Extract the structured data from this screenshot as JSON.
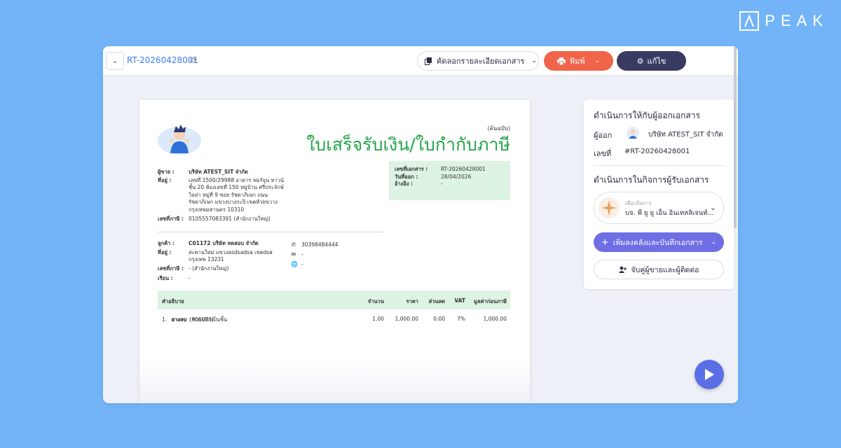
{
  "brand": {
    "name": "PEAK"
  },
  "toolbar": {
    "doc_id": "RT-20260428001",
    "copy_label": "คัดลอกรายละเอียดเอกสาร",
    "print_label": "พิมพ์",
    "edit_label": "แก้ไข"
  },
  "document": {
    "original_label": "(ต้นฉบับ)",
    "title": "ใบเสร็จรับเงิน/ใบกำกับภาษี",
    "seller": {
      "seller_label": "ผู้ขาย :",
      "seller_value": "บริษัท ATEST_SIT จำกัด",
      "address_label": "ที่อยู่ :",
      "address_lines": [
        "เลขที่ 1500/29988 อาคาร ฟอร์จูน ทาวน์",
        "ชั้น 20 ห้องเลขที่ 150 หมู่บ้าน ศรีประจักษ์",
        "วิลล่า หมู่ที่ 9 ซอย รัชดาภิเษก ถนน",
        "รัชดาภิเษก แขวงบางกะปิ เขตห้วยขวาง",
        "กรุงเทพมหานคร 10310"
      ],
      "tax_label": "เลขที่ภาษี :",
      "tax_value": "0105557083391 (สำนักงานใหญ่)"
    },
    "docinfo": {
      "no_label": "เลขที่เอกสาร :",
      "no_value": "RT-20260428001",
      "date_label": "วันที่ออก :",
      "date_value": "28/04/2026",
      "ref_label": "อ้างอิง :",
      "ref_value": "-"
    },
    "customer": {
      "customer_label": "ลูกค้า :",
      "customer_value": "C01172 บริษัท ทดสอบ จำกัด",
      "address_label": "ที่อยู่ :",
      "address_lines": [
        "สะพานใหม่ แขวงasdsadsa เขตdsa",
        "กรุงเทพ 13231"
      ],
      "tax_label": "เลขที่ภาษี :",
      "tax_value": "- (สำนักงานใหญ่)",
      "attn_label": "เรียน :",
      "attn_value": "-"
    },
    "contact": {
      "phone": "30398484444",
      "email": "-",
      "web": "-"
    },
    "table": {
      "headers": {
        "desc": "คำอธิบาย",
        "qty": "จำนวน",
        "price": "ราคา",
        "discount": "ส่วนลด",
        "vat": "VAT",
        "amount": "มูลค่าก่อนภาษี"
      },
      "rows": [
        {
          "no": "1.",
          "name": "ยางลบ",
          "code": "(P00003)",
          "sub": "ยางลบ : ขายปลีกเป็นชิ้น",
          "qty": "1.00",
          "price": "1,000.00",
          "discount": "0.00",
          "vat": "7%",
          "amount": "1,000.00"
        }
      ]
    }
  },
  "side": {
    "issuer_heading": "ดำเนินการให้กับผู้ออกเอกสาร",
    "issuer_label": "ผู้ออก",
    "issuer_value": "บริษัท ATEST_SIT จำกัด",
    "no_label": "เลขที่",
    "no_value": "#RT-20260428001",
    "receiver_heading": "ดำเนินการในกิจการผู้รับเอกสาร",
    "activity_small": "เลือกกิจการ",
    "activity_name": "บจ. พี ยู ยู เอ็น อินเทลลิเจนท์...",
    "add_button": "เพิ่มลงคลังและบันทึกเอกสาร",
    "match_button": "จับคู่ผู้ขายและผู้ติดต่อ"
  },
  "colors": {
    "background": "#73b4f8",
    "print": "#f06449",
    "edit": "#393b63",
    "title_green": "#23a44a",
    "accent_purple": "#6f6ee5"
  }
}
